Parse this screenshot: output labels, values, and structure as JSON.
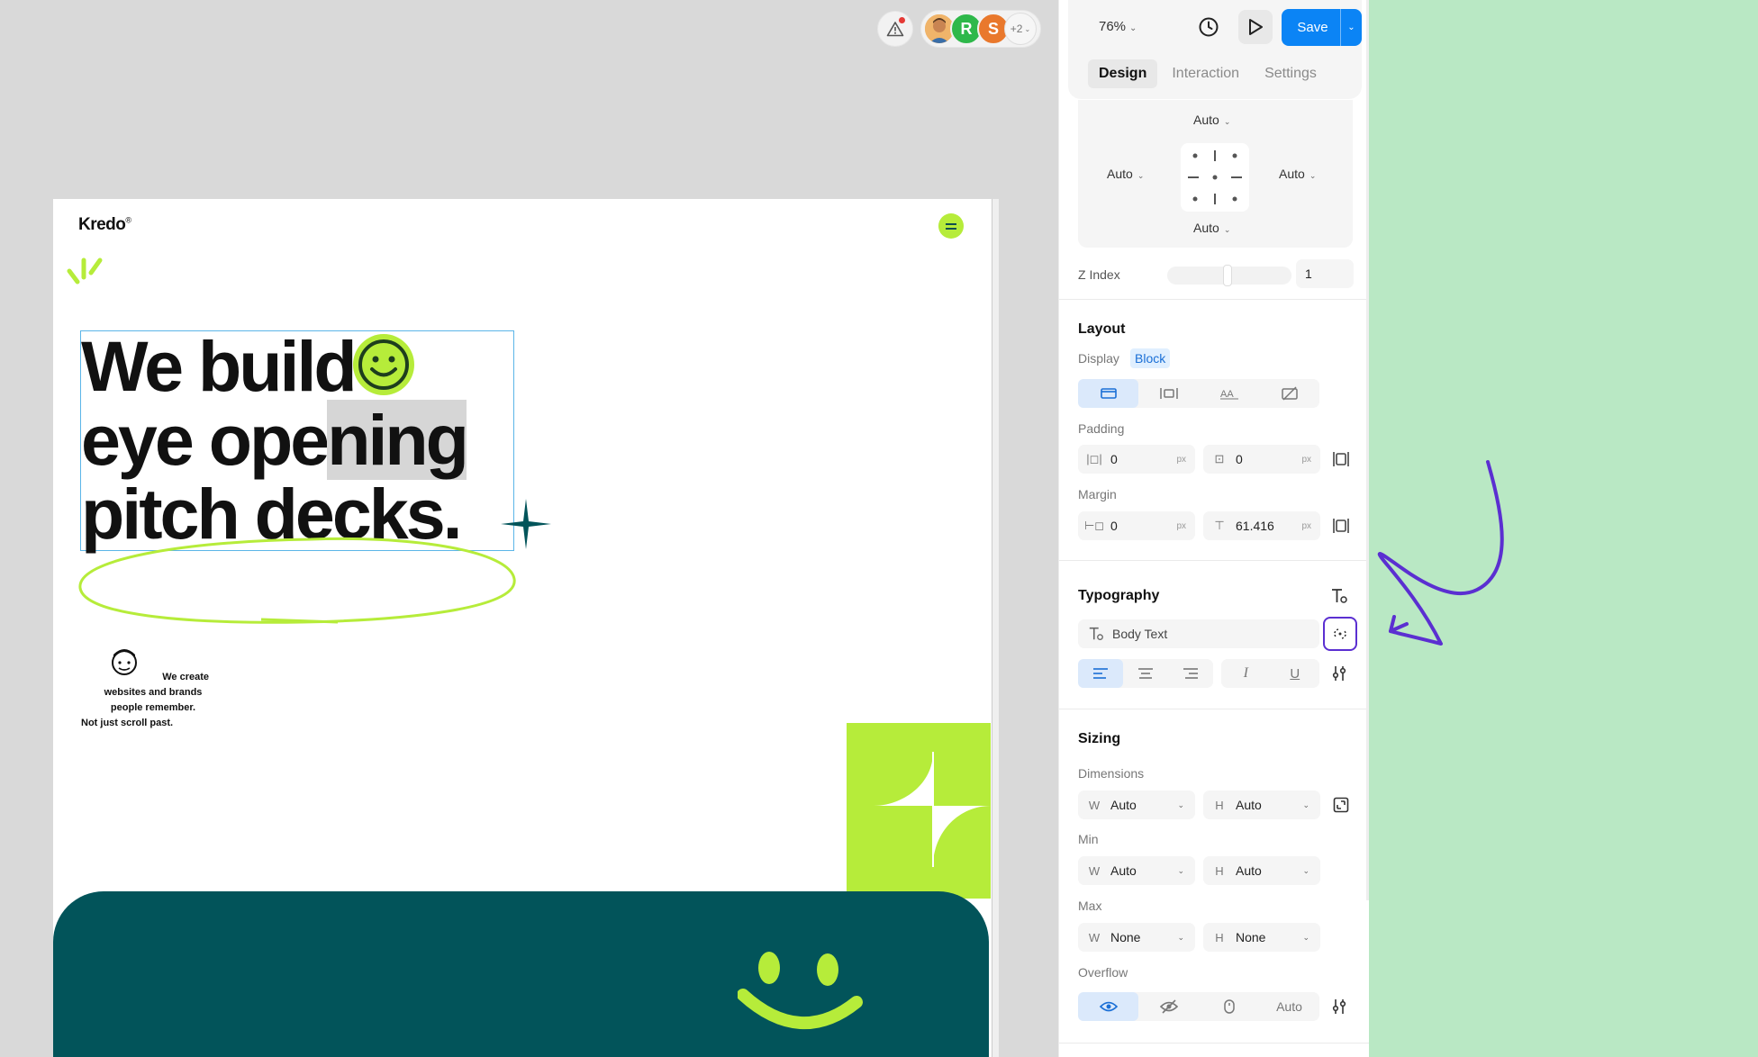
{
  "collab": {
    "warning_icon": "warning-icon",
    "avatars": [
      {
        "initial": "",
        "color": "#e8a65a"
      },
      {
        "initial": "R",
        "color": "#2eb84a"
      },
      {
        "initial": "S",
        "color": "#e9782c"
      }
    ],
    "more_label": "+2"
  },
  "site": {
    "logo": "Kredo",
    "logo_mark": "®",
    "headline": [
      "We build",
      "eye ope",
      "ning",
      "pitch decks."
    ],
    "blurb": [
      "We create",
      "websites and brands",
      "people remember.",
      "Not just scroll past."
    ],
    "colors": {
      "lime": "#b6ec3a",
      "teal": "#02545a"
    }
  },
  "panel": {
    "zoom": "76%",
    "save_label": "Save",
    "tabs": [
      "Design",
      "Interaction",
      "Settings"
    ],
    "active_tab": "Design",
    "position": {
      "top": "Auto",
      "left": "Auto",
      "right": "Auto",
      "bottom": "Auto"
    },
    "z_index": {
      "label": "Z Index",
      "value": "1"
    },
    "layout": {
      "title": "Layout",
      "display_label": "Display",
      "display_value": "Block",
      "padding_label": "Padding",
      "padding_x": "0",
      "padding_y": "0",
      "margin_label": "Margin",
      "margin_x": "0",
      "margin_y": "61.416",
      "unit": "px"
    },
    "typography": {
      "title": "Typography",
      "style": "Body Text"
    },
    "sizing": {
      "title": "Sizing",
      "dimensions_label": "Dimensions",
      "min_label": "Min",
      "max_label": "Max",
      "w_label": "W",
      "h_label": "H",
      "dim_w": "Auto",
      "dim_h": "Auto",
      "min_w": "Auto",
      "min_h": "Auto",
      "max_w": "None",
      "max_h": "None",
      "overflow_label": "Overflow",
      "overflow_auto": "Auto"
    },
    "accent": "#0b84f5",
    "highlight": "#5b2fd1"
  }
}
